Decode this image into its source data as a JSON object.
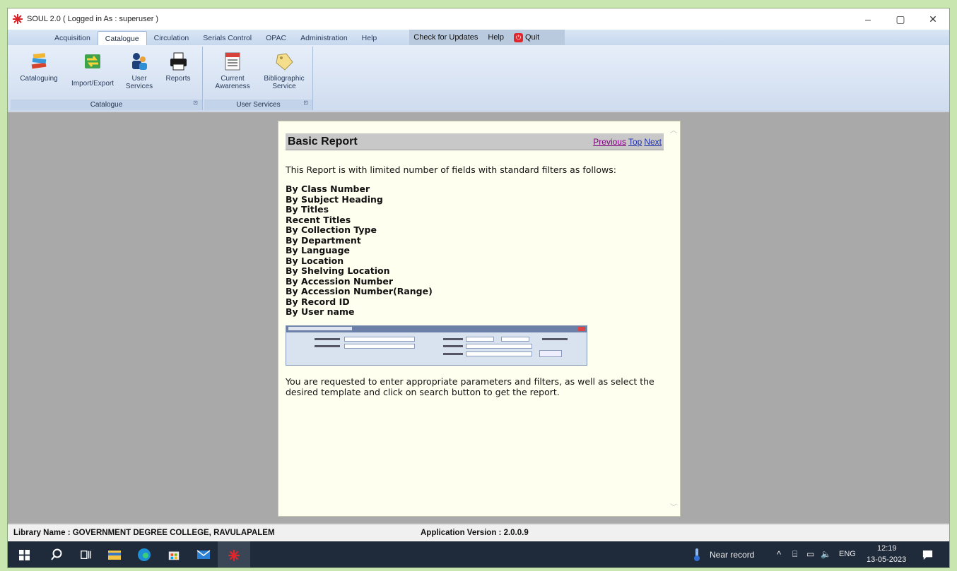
{
  "window": {
    "title": "SOUL 2.0 ( Logged in As : superuser )",
    "controls": [
      "–",
      "▢",
      "✕"
    ]
  },
  "menu": {
    "tabs": [
      "Acquisition",
      "Catalogue",
      "Circulation",
      "Serials Control",
      "OPAC",
      "Administration",
      "Help"
    ],
    "active_tab": "Catalogue",
    "check_updates": "Check for Updates",
    "help": "Help",
    "quit": "Quit"
  },
  "ribbon": {
    "groups": [
      {
        "label": "Catalogue",
        "buttons": [
          "Cataloguing",
          "Import/Export",
          "User Services",
          "Reports"
        ]
      },
      {
        "label": "User Services",
        "buttons": [
          "Current Awareness",
          "Bibliographic Service"
        ]
      }
    ]
  },
  "doc": {
    "title": "Basic Report",
    "nav": {
      "previous": "Previous",
      "top": "Top",
      "next": "Next"
    },
    "intro": "This Report is with limited number of fields with standard filters as follows:",
    "filters": [
      "By Class Number",
      "By Subject Heading",
      "By Titles",
      "Recent Titles",
      "By Collection Type",
      "By Department",
      "By Language",
      "By Location",
      "By Shelving Location",
      "By Accession Number",
      "By Accession Number(Range)",
      "By Record ID",
      "By User name"
    ],
    "outro": "You are requested to enter appropriate parameters and filters, as well as select the desired template and click on search button to get the report."
  },
  "status": {
    "library": "Library Name : GOVERNMENT DEGREE COLLEGE, RAVULAPALEM",
    "version": "Application Version : 2.0.0.9"
  },
  "taskbar": {
    "weather": "Near record",
    "lang": "ENG",
    "time": "12:19",
    "date": "13-05-2023"
  }
}
